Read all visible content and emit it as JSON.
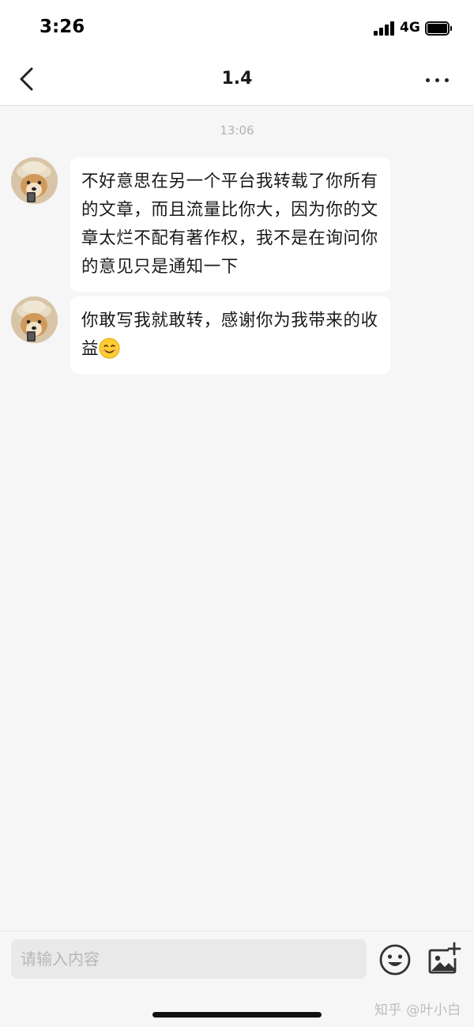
{
  "status_bar": {
    "time": "3:26",
    "network": "4G"
  },
  "nav": {
    "title": "1.4",
    "back_icon": "chevron-left-icon",
    "more_icon": "more-horizontal-icon"
  },
  "chat": {
    "timestamp": "13:06",
    "messages": [
      {
        "avatar_icon": "dog-avatar",
        "text": "不好意思在另一个平台我转载了你所有的文章，而且流量比你大，因为你的文章太烂不配有著作权，我不是在询问你的意见只是通知一下"
      },
      {
        "avatar_icon": "dog-avatar",
        "text": "你敢写我就敢转，感谢你为我带来的收益",
        "trailing_emoji": "smiling-face-icon"
      }
    ]
  },
  "input_bar": {
    "placeholder": "请输入内容",
    "emoji_icon": "emoji-icon",
    "image_icon": "add-image-icon"
  },
  "watermark": "知乎 @叶小白",
  "colors": {
    "background": "#f6f6f6",
    "bubble": "#ffffff",
    "timestamp": "#b2b2b2"
  }
}
